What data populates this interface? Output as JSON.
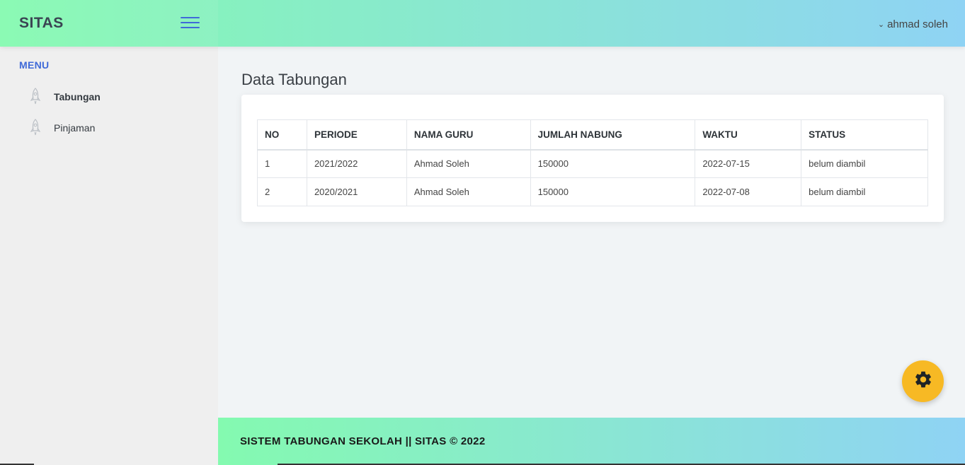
{
  "header": {
    "logo": "SITAS",
    "user_name": "ahmad soleh"
  },
  "sidebar": {
    "heading": "MENU",
    "items": [
      {
        "label": "Tabungan",
        "icon": "rocket-icon",
        "active": true
      },
      {
        "label": "Pinjaman",
        "icon": "rocket-icon",
        "active": false
      }
    ]
  },
  "main": {
    "title": "Data Tabungan",
    "table": {
      "columns": [
        "NO",
        "PERIODE",
        "NAMA GURU",
        "JUMLAH NABUNG",
        "WAKTU",
        "STATUS"
      ],
      "rows": [
        [
          "1",
          "2021/2022",
          "Ahmad Soleh",
          "150000",
          "2022-07-15",
          "belum diambil"
        ],
        [
          "2",
          "2020/2021",
          "Ahmad Soleh",
          "150000",
          "2022-07-08",
          "belum diambil"
        ]
      ]
    }
  },
  "footer": {
    "text": "SISTEM TABUNGAN SEKOLAH || SITAS © 2022"
  },
  "fab": {
    "icon": "gear-icon"
  },
  "colors": {
    "accent": "#3f6ad8",
    "fab": "#f7b924",
    "gradient_start": "#84fab0",
    "gradient_end": "#8fd3f4"
  }
}
